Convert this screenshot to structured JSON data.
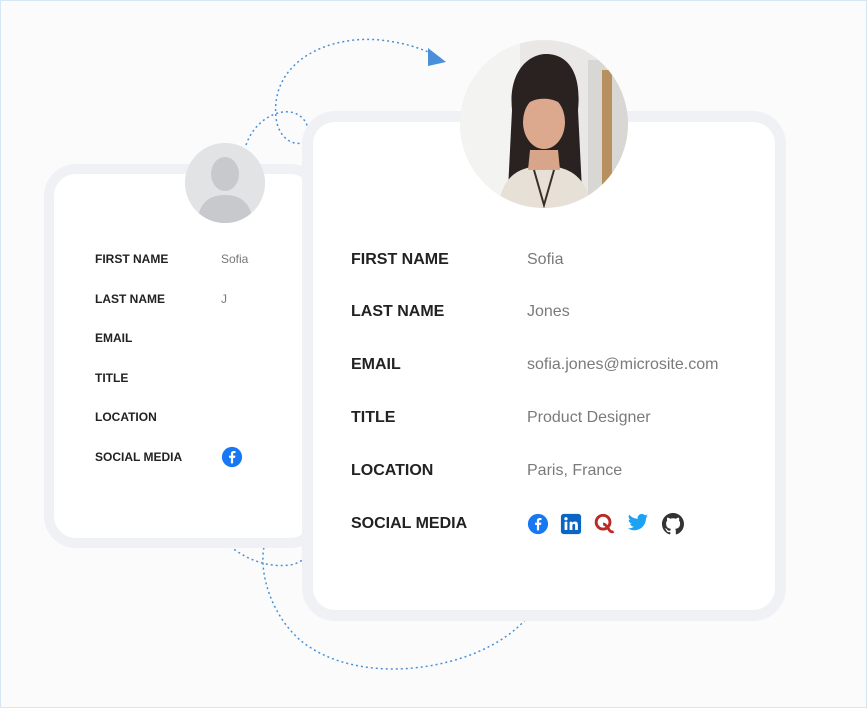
{
  "small_card": {
    "rows": [
      {
        "label": "FIRST NAME",
        "value": "Sofia"
      },
      {
        "label": "LAST NAME",
        "value": "J"
      },
      {
        "label": "EMAIL",
        "value": ""
      },
      {
        "label": "TITLE",
        "value": ""
      },
      {
        "label": "LOCATION",
        "value": ""
      },
      {
        "label": "SOCIAL MEDIA",
        "value": ""
      }
    ],
    "social_icons": [
      "facebook-icon"
    ]
  },
  "large_card": {
    "rows": [
      {
        "label": "FIRST NAME",
        "value": "Sofia"
      },
      {
        "label": "LAST NAME",
        "value": "Jones"
      },
      {
        "label": "EMAIL",
        "value": "sofia.jones@microsite.com"
      },
      {
        "label": "TITLE",
        "value": "Product Designer"
      },
      {
        "label": "LOCATION",
        "value": "Paris, France"
      },
      {
        "label": "SOCIAL MEDIA",
        "value": ""
      }
    ],
    "social_icons": [
      "facebook-icon",
      "linkedin-icon",
      "quora-icon",
      "twitter-icon",
      "github-icon"
    ]
  },
  "colors": {
    "facebook": "#1877f2",
    "linkedin": "#0a66c2",
    "quora": "#b92b27",
    "twitter": "#1da1f2",
    "github": "#333333",
    "connector": "#4a90d9"
  }
}
